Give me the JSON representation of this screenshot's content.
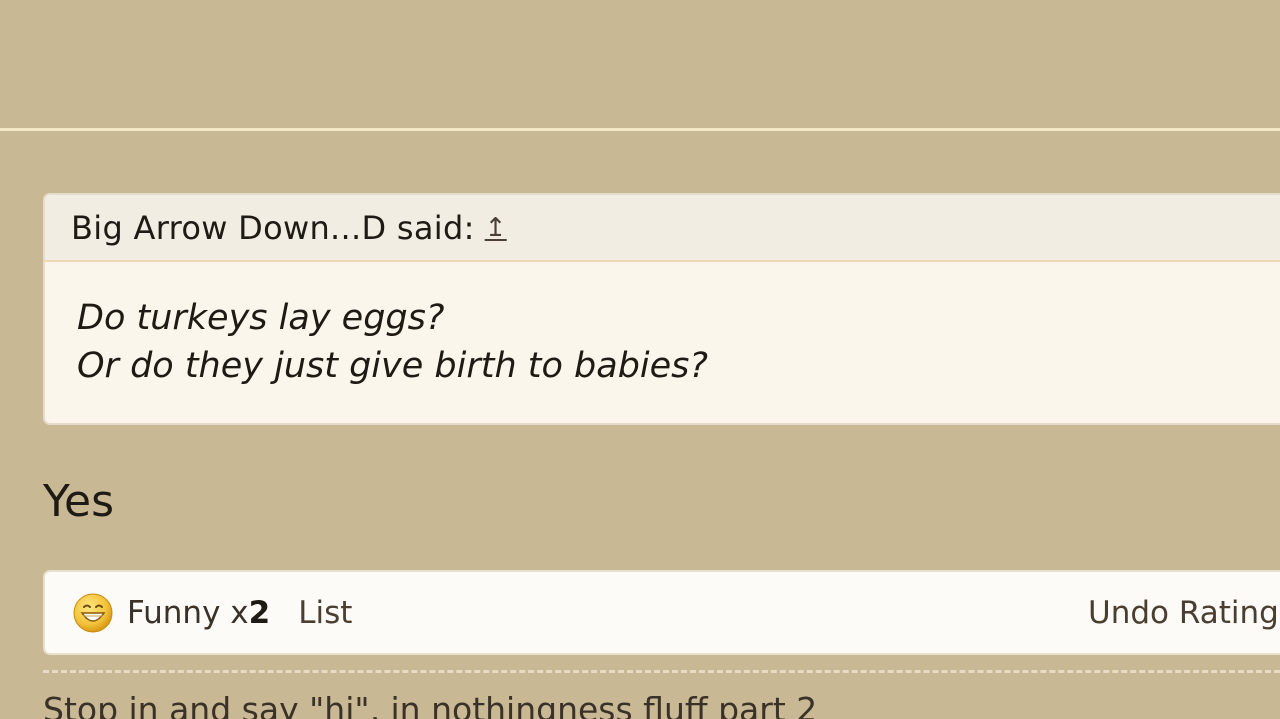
{
  "quote": {
    "author_line": "Big Arrow Down...D said:",
    "jump_icon": "↥",
    "lines": [
      "Do turkeys lay eggs?",
      "Or do they just give birth to babies?"
    ]
  },
  "reply": {
    "text": "Yes"
  },
  "ratings": {
    "icon": "funny-smiley-icon",
    "label": "Funny x ",
    "count": "2",
    "list_label": "List",
    "undo_label": "Undo Rating"
  },
  "signature": {
    "text": "Stop in and say \"hi\", in nothingness fluff part 2"
  },
  "colors": {
    "background": "#c8b894",
    "quote_bg": "#faf6ec",
    "ratings_bg": "#fcfbf7",
    "smiley": "#f3c23a"
  }
}
